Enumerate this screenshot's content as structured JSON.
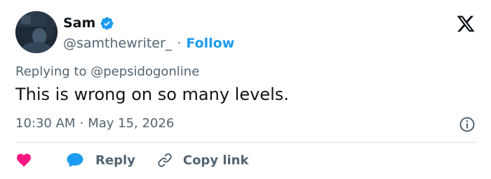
{
  "author": {
    "name": "Sam",
    "handle": "@samthewriter_",
    "separator": "·",
    "follow_label": "Follow",
    "verified_color": "#1d9bf0",
    "avatar": "dark-photo-avatar"
  },
  "header": {
    "logo_icon": "x-logo-icon"
  },
  "tweet": {
    "replying_prefix": "Replying to",
    "replying_to": "@pepsidogonline",
    "text": "This is wrong on so many levels.",
    "time": "10:30 AM",
    "meta_separator": "·",
    "date": "May 15, 2026",
    "info_icon": "info-icon"
  },
  "actions": {
    "like_icon": "heart-icon",
    "like_color": "#f91880",
    "reply_icon": "speech-bubble-icon",
    "reply_color": "#1d9bf0",
    "reply_label": "Reply",
    "copy_icon": "link-icon",
    "copy_label": "Copy link"
  },
  "colors": {
    "accent": "#1d9bf0",
    "text_primary": "#0f1419",
    "text_secondary": "#536471",
    "divider": "#cfd9de"
  }
}
